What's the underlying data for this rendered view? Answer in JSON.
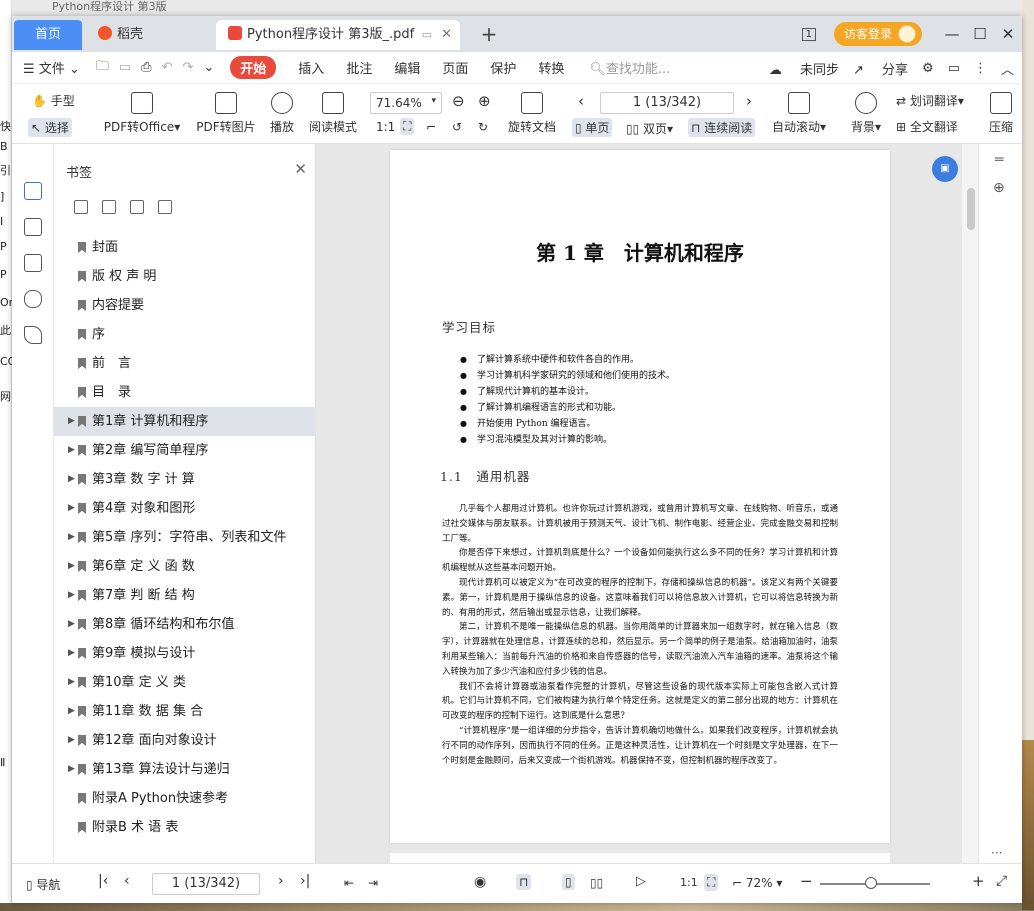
{
  "desktop": {
    "bg_title": "Python程序设计 第3版",
    "left_fragments": [
      "快",
      "B",
      "引",
      "]",
      "Ⅰ",
      "P",
      "P",
      "Or",
      "此",
      "CO",
      "网",
      "Ⅱ"
    ]
  },
  "tabs": {
    "home": "首页",
    "daoke": "稻壳",
    "doc": "Python程序设计 第3版_.pdf"
  },
  "topbar": {
    "visitor_login": "访客登录",
    "badge": "1"
  },
  "menu": {
    "file": "文件",
    "items": [
      "开始",
      "插入",
      "批注",
      "编辑",
      "页面",
      "保护",
      "转换"
    ],
    "search_placeholder": "查找功能...",
    "unsynced": "未同步",
    "share": "分享"
  },
  "ribbon": {
    "hand": "手型",
    "select": "选择",
    "pdf_to_office": "PDF转Office",
    "pdf_to_image": "PDF转图片",
    "play": "播放",
    "read_mode": "阅读模式",
    "zoom": "71.64%",
    "rotate": "旋转文档",
    "page_indicator": "1 (13/342)",
    "single": "单页",
    "double": "双页",
    "continuous": "连续阅读",
    "auto_scroll": "自动滚动",
    "background": "背景",
    "translate_word": "划词翻译",
    "translate_full": "全文翻译",
    "compress": "压缩"
  },
  "bookmarks": {
    "title": "书签",
    "items": [
      {
        "label": "封面",
        "expandable": false
      },
      {
        "label": "版 权 声 明",
        "expandable": false
      },
      {
        "label": "内容提要",
        "expandable": false
      },
      {
        "label": "序",
        "expandable": false
      },
      {
        "label": "前　言",
        "expandable": false
      },
      {
        "label": "目　录",
        "expandable": false
      },
      {
        "label": "第1章  计算机和程序",
        "expandable": true,
        "selected": true
      },
      {
        "label": "第2章  编写简单程序",
        "expandable": true
      },
      {
        "label": "第3章  数 字 计 算",
        "expandable": true
      },
      {
        "label": "第4章  对象和图形",
        "expandable": true
      },
      {
        "label": "第5章  序列：字符串、列表和文件",
        "expandable": true
      },
      {
        "label": "第6章  定 义 函 数",
        "expandable": true
      },
      {
        "label": "第7章  判 断 结 构",
        "expandable": true
      },
      {
        "label": "第8章  循环结构和布尔值",
        "expandable": true
      },
      {
        "label": "第9章  模拟与设计",
        "expandable": true
      },
      {
        "label": "第10章  定 义 类",
        "expandable": true
      },
      {
        "label": "第11章  数 据 集 合",
        "expandable": true
      },
      {
        "label": "第12章  面向对象设计",
        "expandable": true
      },
      {
        "label": "第13章  算法设计与递归",
        "expandable": true
      },
      {
        "label": "附录A  Python快速参考",
        "expandable": false
      },
      {
        "label": "附录B  术 语 表",
        "expandable": false
      }
    ]
  },
  "page": {
    "chapter_title": "第 1 章　计算机和程序",
    "goals_heading": "学习目标",
    "goals": [
      "了解计算系统中硬件和软件各自的作用。",
      "学习计算机科学家研究的领域和他们使用的技术。",
      "了解现代计算机的基本设计。",
      "了解计算机编程语言的形式和功能。",
      "开始使用 Python 编程语言。",
      "学习混沌模型及其对计算的影响。"
    ],
    "section": "1.1　通用机器",
    "paragraphs": [
      "几乎每个人都用过计算机。也许你玩过计算机游戏，或曾用计算机写文章、在线购物、听音乐，或通过社交媒体与朋友联系。计算机被用于预测天气、设计飞机、制作电影、经营企业、完成金融交易和控制工厂等。",
      "你是否停下来想过，计算机到底是什么？一个设备如何能执行这么多不同的任务？学习计算机和计算机编程就从这些基本问题开始。",
      "现代计算机可以被定义为“在可改变的程序的控制下，存储和操纵信息的机器”。该定义有两个关键要素。第一，计算机是用于操纵信息的设备。这意味着我们可以将信息放入计算机，它可以将信息转换为新的、有用的形式，然后输出或显示信息，让我们解释。",
      "第二，计算机不是唯一能操纵信息的机器。当你用简单的计算器来加一组数字时，就在输入信息（数字），计算器就在处理信息，计算连续的总和，然后显示。另一个简单的例子是油泵。给油箱加油时，油泵利用某些输入：当前每升汽油的价格和来自传感器的信号，读取汽油流入汽车油箱的速率。油泵将这个输入转换为加了多少汽油和应付多少钱的信息。",
      "我们不会将计算器或油泵看作完整的计算机，尽管这些设备的现代版本实际上可能包含嵌入式计算机。它们与计算机不同，它们被构建为执行单个特定任务。这就是定义的第二部分出现的地方：计算机在可改变的程序的控制下运行。这到底是什么意思？",
      "“计算机程序”是一组详细的分步指令，告诉计算机确切地做什么。如果我们改变程序，计算机就会执行不同的动作序列，因而执行不同的任务。正是这种灵活性，让计算机在一个时刻是文字处理器，在下一个时刻是金融顾问，后来又变成一个街机游戏。机器保持不变，但控制机器的程序改变了。"
    ]
  },
  "status": {
    "nav": "导航",
    "page_indicator": "1 (13/342)",
    "zoom": "72%",
    "zoom_fraction": 0.45
  },
  "colors": {
    "accent": "#4b8ef5",
    "start": "#e84a3b",
    "visitor": "#f5a623"
  }
}
